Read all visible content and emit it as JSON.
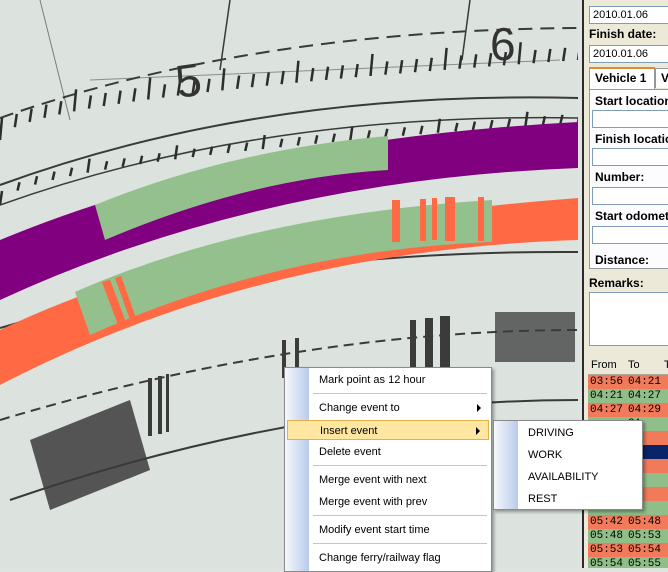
{
  "disc": {
    "scale_numbers": [
      "5",
      "6"
    ]
  },
  "panel": {
    "start_date_value": "2010.01.06",
    "finish_date_label": "Finish date:",
    "finish_date_value": "2010.01.06",
    "tabs": [
      {
        "label": "Vehicle 1"
      },
      {
        "label": "V"
      }
    ],
    "start_location_label": "Start location",
    "finish_location_label": "Finish location",
    "number_label": "Number:",
    "start_odometer_label": "Start odometer",
    "distance_label": "Distance:",
    "remarks_label": "Remarks:"
  },
  "events_grid": {
    "headers": [
      "From",
      "To",
      "T"
    ],
    "rows": [
      {
        "from": "03:56",
        "to": "04:21",
        "kind": "driving"
      },
      {
        "from": "04:21",
        "to": "04:27",
        "kind": "rest"
      },
      {
        "from": "04:27",
        "to": "04:29",
        "kind": "driving"
      },
      {
        "from": "",
        "to": "31",
        "kind": "rest"
      },
      {
        "from": "",
        "to": "32",
        "kind": "driving"
      },
      {
        "from": "",
        "to": "32",
        "kind": "selected"
      },
      {
        "from": "",
        "to": "34",
        "kind": "driving"
      },
      {
        "from": "",
        "to": "39",
        "kind": "rest"
      },
      {
        "from": "",
        "to": "41",
        "kind": "driving"
      },
      {
        "from": "",
        "to": "42",
        "kind": "rest"
      },
      {
        "from": "05:42",
        "to": "05:48",
        "kind": "driving"
      },
      {
        "from": "05:48",
        "to": "05:53",
        "kind": "rest"
      },
      {
        "from": "05:53",
        "to": "05:54",
        "kind": "driving"
      },
      {
        "from": "05:54",
        "to": "05:55",
        "kind": "rest"
      }
    ]
  },
  "context_menu": {
    "items": [
      {
        "label": "Mark point as 12 hour",
        "submenu": false
      },
      {
        "label": "Change event to",
        "submenu": true
      },
      {
        "label": "Insert event",
        "submenu": true,
        "highlighted": true
      },
      {
        "label": "Delete event",
        "submenu": false
      },
      {
        "label": "Merge event with next",
        "submenu": false
      },
      {
        "label": "Merge event with prev",
        "submenu": false
      },
      {
        "label": "Modify event start time",
        "submenu": false
      },
      {
        "label": "Change ferry/railway flag",
        "submenu": false
      }
    ]
  },
  "submenu": {
    "items": [
      {
        "label": "DRIVING"
      },
      {
        "label": "WORK"
      },
      {
        "label": "AVAILABILITY"
      },
      {
        "label": "REST"
      }
    ]
  },
  "colors": {
    "purple_band": "#800080",
    "green_band": "#93c08c",
    "orange_band": "#ff6a45",
    "highlight": "#ffe7a2"
  }
}
